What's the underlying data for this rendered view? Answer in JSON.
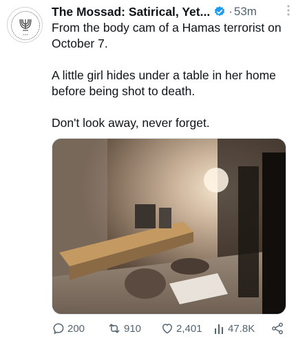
{
  "tweet": {
    "author_name": "The Mossad: Satirical, Yet...",
    "separator": "·",
    "time": "53m",
    "paragraphs": [
      "From the body cam of a Hamas terrorist on October 7.",
      "A little girl hides under a table in her home before being shot to death.",
      "Don't look away, never forget."
    ]
  },
  "actions": {
    "replies": "200",
    "reposts": "910",
    "likes": "2,401",
    "views": "47.8K"
  },
  "colors": {
    "text": "#0f1419",
    "secondary": "#536471",
    "verified": "#1d9bf0"
  },
  "icons": [
    "avatar-logo",
    "verified-badge-icon",
    "more-icon",
    "reply-icon",
    "repost-icon",
    "like-icon",
    "views-icon",
    "share-icon"
  ]
}
